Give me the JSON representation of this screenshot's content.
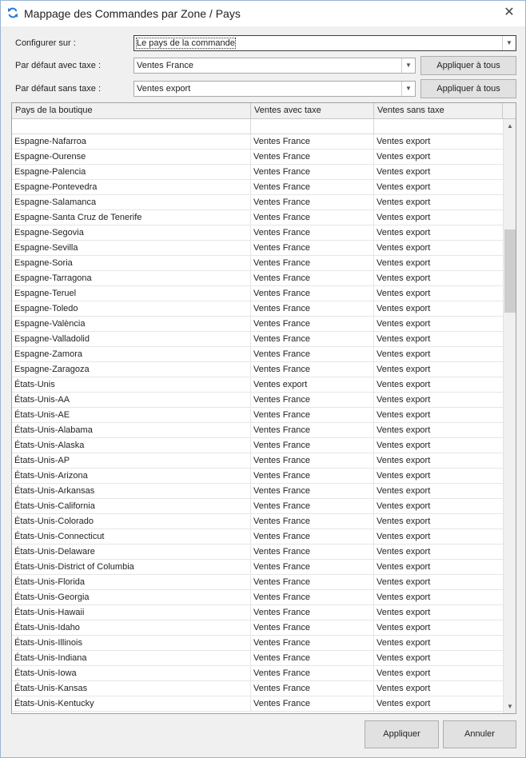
{
  "window": {
    "title": "Mappage des Commandes par Zone / Pays",
    "close_glyph": "✕",
    "icon": "refresh-arrows-icon"
  },
  "form": {
    "configure_label": "Configurer sur :",
    "configure_value": "Le pays de la commande",
    "default_tax_label": "Par défaut avec taxe :",
    "default_tax_value": "Ventes France",
    "default_notax_label": "Par défaut sans taxe :",
    "default_notax_value": "Ventes export",
    "apply_all_label": "Appliquer à tous"
  },
  "grid": {
    "columns": [
      "Pays de la boutique",
      "Ventes avec taxe",
      "Ventes sans taxe"
    ],
    "rows": [
      [
        "Espagne-Nafarroa",
        "Ventes France",
        "Ventes export"
      ],
      [
        "Espagne-Ourense",
        "Ventes France",
        "Ventes export"
      ],
      [
        "Espagne-Palencia",
        "Ventes France",
        "Ventes export"
      ],
      [
        "Espagne-Pontevedra",
        "Ventes France",
        "Ventes export"
      ],
      [
        "Espagne-Salamanca",
        "Ventes France",
        "Ventes export"
      ],
      [
        "Espagne-Santa Cruz de Tenerife",
        "Ventes France",
        "Ventes export"
      ],
      [
        "Espagne-Segovia",
        "Ventes France",
        "Ventes export"
      ],
      [
        "Espagne-Sevilla",
        "Ventes France",
        "Ventes export"
      ],
      [
        "Espagne-Soria",
        "Ventes France",
        "Ventes export"
      ],
      [
        "Espagne-Tarragona",
        "Ventes France",
        "Ventes export"
      ],
      [
        "Espagne-Teruel",
        "Ventes France",
        "Ventes export"
      ],
      [
        "Espagne-Toledo",
        "Ventes France",
        "Ventes export"
      ],
      [
        "Espagne-València",
        "Ventes France",
        "Ventes export"
      ],
      [
        "Espagne-Valladolid",
        "Ventes France",
        "Ventes export"
      ],
      [
        "Espagne-Zamora",
        "Ventes France",
        "Ventes export"
      ],
      [
        "Espagne-Zaragoza",
        "Ventes France",
        "Ventes export"
      ],
      [
        "États-Unis",
        "Ventes export",
        "Ventes export"
      ],
      [
        "États-Unis-AA",
        "Ventes France",
        "Ventes export"
      ],
      [
        "États-Unis-AE",
        "Ventes France",
        "Ventes export"
      ],
      [
        "États-Unis-Alabama",
        "Ventes France",
        "Ventes export"
      ],
      [
        "États-Unis-Alaska",
        "Ventes France",
        "Ventes export"
      ],
      [
        "États-Unis-AP",
        "Ventes France",
        "Ventes export"
      ],
      [
        "États-Unis-Arizona",
        "Ventes France",
        "Ventes export"
      ],
      [
        "États-Unis-Arkansas",
        "Ventes France",
        "Ventes export"
      ],
      [
        "États-Unis-California",
        "Ventes France",
        "Ventes export"
      ],
      [
        "États-Unis-Colorado",
        "Ventes France",
        "Ventes export"
      ],
      [
        "États-Unis-Connecticut",
        "Ventes France",
        "Ventes export"
      ],
      [
        "États-Unis-Delaware",
        "Ventes France",
        "Ventes export"
      ],
      [
        "États-Unis-District of Columbia",
        "Ventes France",
        "Ventes export"
      ],
      [
        "États-Unis-Florida",
        "Ventes France",
        "Ventes export"
      ],
      [
        "États-Unis-Georgia",
        "Ventes France",
        "Ventes export"
      ],
      [
        "États-Unis-Hawaii",
        "Ventes France",
        "Ventes export"
      ],
      [
        "États-Unis-Idaho",
        "Ventes France",
        "Ventes export"
      ],
      [
        "États-Unis-Illinois",
        "Ventes France",
        "Ventes export"
      ],
      [
        "États-Unis-Indiana",
        "Ventes France",
        "Ventes export"
      ],
      [
        "États-Unis-Iowa",
        "Ventes France",
        "Ventes export"
      ],
      [
        "États-Unis-Kansas",
        "Ventes France",
        "Ventes export"
      ],
      [
        "États-Unis-Kentucky",
        "Ventes France",
        "Ventes export"
      ]
    ]
  },
  "footer": {
    "apply_label": "Appliquer",
    "cancel_label": "Annuler"
  }
}
